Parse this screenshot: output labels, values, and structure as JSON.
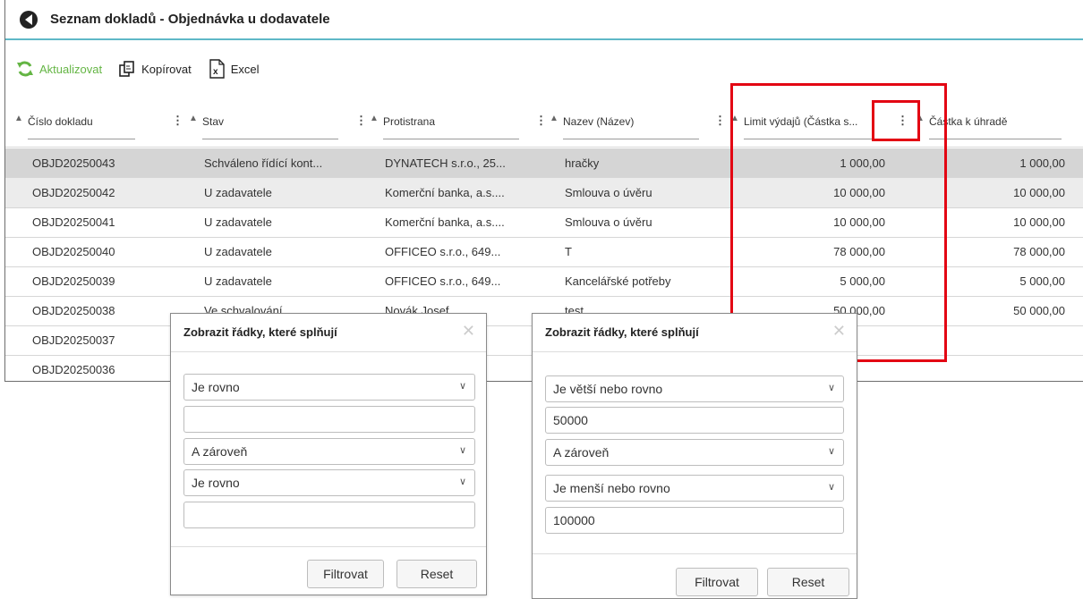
{
  "window": {
    "title": "Seznam dokladů - Objednávka u dodavatele"
  },
  "toolbar": {
    "refresh": "Aktualizovat",
    "copy": "Kopírovat",
    "excel": "Excel"
  },
  "columns": [
    {
      "label": "Číslo dokladu"
    },
    {
      "label": "Stav"
    },
    {
      "label": "Protistrana"
    },
    {
      "label": "Nazev (Název)"
    },
    {
      "label": "Limit výdajů (Částka s..."
    },
    {
      "label": "Částka k úhradě"
    }
  ],
  "rows": [
    {
      "number": "OBJD20250043",
      "status": "Schváleno řídící kont...",
      "party": "DYNATECH s.r.o., 25...",
      "name": "hračky",
      "limit": "1 000,00",
      "amount": "1 000,00"
    },
    {
      "number": "OBJD20250042",
      "status": "U zadavatele",
      "party": "Komerční banka, a.s....",
      "name": "Smlouva o úvěru",
      "limit": "10 000,00",
      "amount": "10 000,00"
    },
    {
      "number": "OBJD20250041",
      "status": "U zadavatele",
      "party": "Komerční banka, a.s....",
      "name": "Smlouva o úvěru",
      "limit": "10 000,00",
      "amount": "10 000,00"
    },
    {
      "number": "OBJD20250040",
      "status": "U zadavatele",
      "party": "OFFICEO s.r.o., 649...",
      "name": "T",
      "limit": "78 000,00",
      "amount": "78 000,00"
    },
    {
      "number": "OBJD20250039",
      "status": "U zadavatele",
      "party": "OFFICEO s.r.o., 649...",
      "name": "Kancelářské potřeby",
      "limit": "5 000,00",
      "amount": "5 000,00"
    },
    {
      "number": "OBJD20250038",
      "status": "Ve schvalování",
      "party": "Novák Josef",
      "name": "test",
      "limit": "50 000,00",
      "amount": "50 000,00"
    },
    {
      "number": "OBJD20250037",
      "status": "",
      "party": "",
      "name": "",
      "limit": "",
      "amount": ""
    },
    {
      "number": "OBJD20250036",
      "status": "",
      "party": "",
      "name": "",
      "limit": "",
      "amount": ""
    }
  ],
  "filter_left": {
    "title": "Zobrazit řádky, které splňují",
    "operator1": "Je rovno",
    "value1": "",
    "logic": "A zároveň",
    "operator2": "Je rovno",
    "value2": "",
    "filter_button": "Filtrovat",
    "reset_button": "Reset"
  },
  "filter_right": {
    "title": "Zobrazit řádky, které splňují",
    "operator1": "Je větší nebo rovno",
    "value1": "50000",
    "logic": "A zároveň",
    "operator2": "Je menší nebo rovno",
    "value2": "100000",
    "filter_button": "Filtrovat",
    "reset_button": "Reset"
  },
  "colors": {
    "highlight": "#e30613",
    "accent": "#5fb8c7",
    "refresh": "#64b544"
  }
}
